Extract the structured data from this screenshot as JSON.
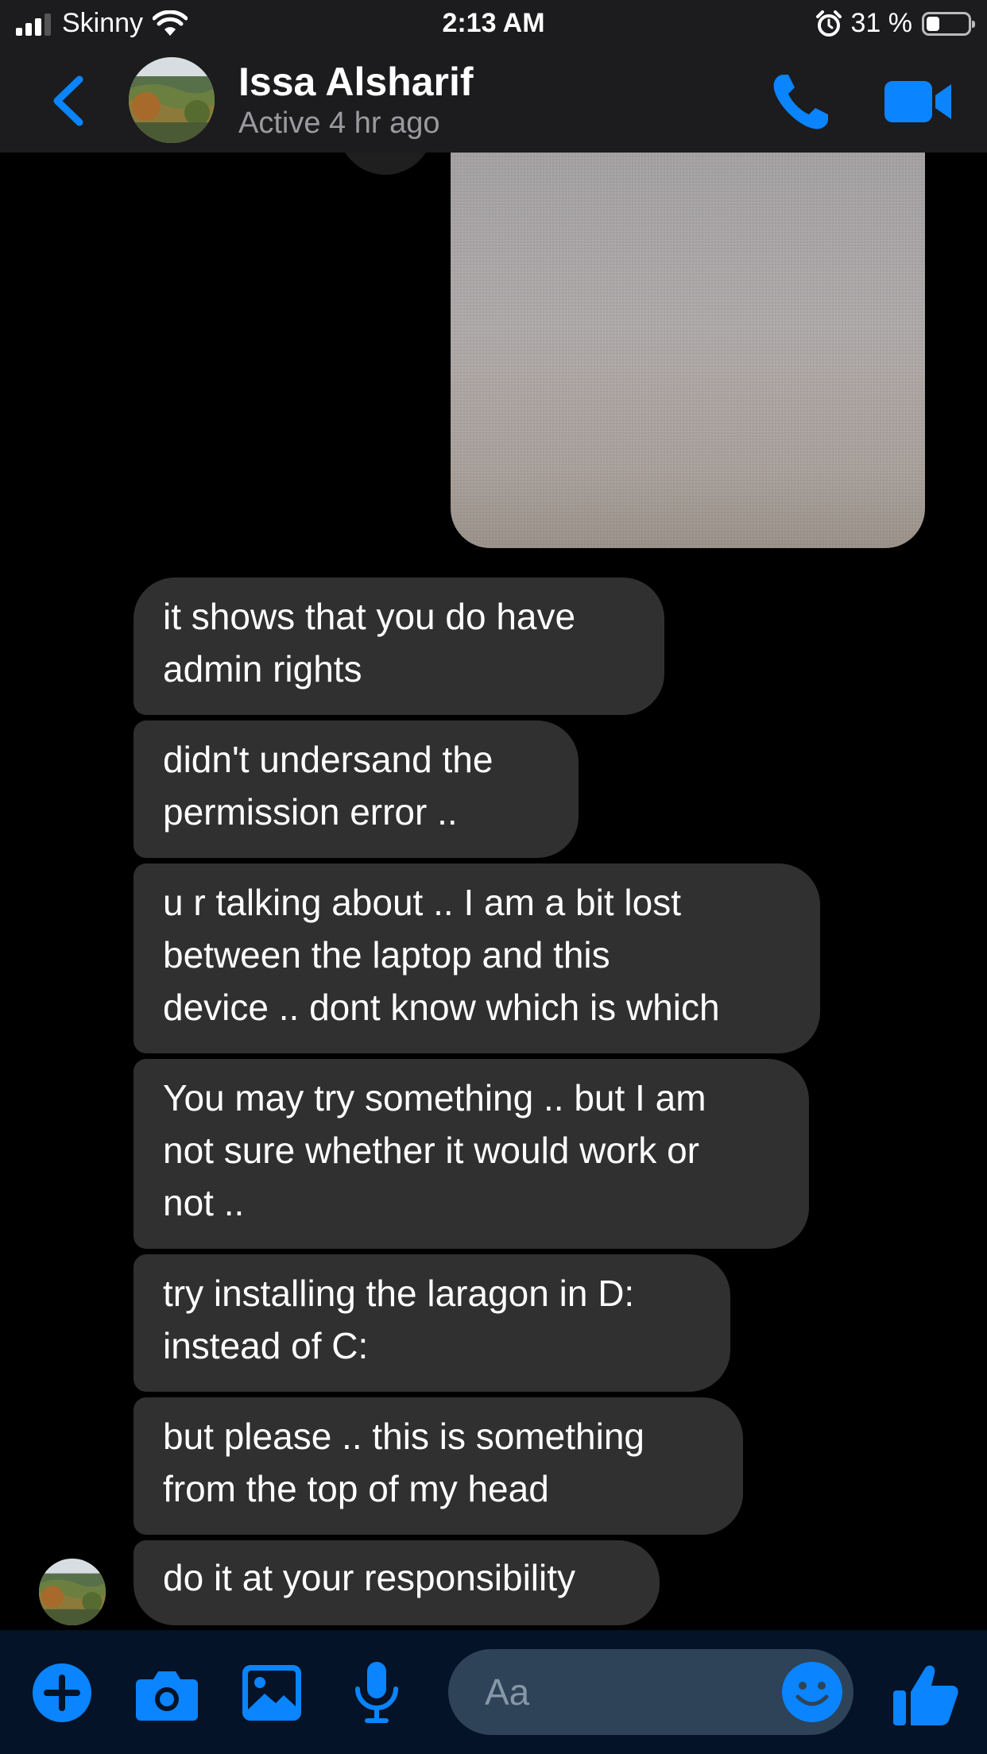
{
  "status_bar": {
    "carrier": "Skinny",
    "time": "2:13 AM",
    "battery_percent": "31 %",
    "battery_level": 0.31,
    "icons": [
      "signal-icon",
      "wifi-icon",
      "alarm-icon",
      "battery-icon"
    ]
  },
  "header": {
    "contact_name": "Issa Alsharif",
    "status": "Active 4 hr ago",
    "icons": [
      "back-chevron-icon",
      "phone-icon",
      "video-camera-icon"
    ]
  },
  "messages": [
    {
      "text": "it shows that you do have\nadmin rights"
    },
    {
      "text": "didn't undersand the\npermission error .."
    },
    {
      "text": "u r talking about .. I am a bit lost\nbetween the laptop and this\ndevice .. dont know which is which"
    },
    {
      "text": "You may try something .. but I am\nnot sure whether it would work or\nnot .."
    },
    {
      "text": "try installing the laragon in D:\ninstead of C:"
    },
    {
      "text": "but please .. this is something\nfrom the top of my head"
    },
    {
      "text": "do it at your responsibility"
    }
  ],
  "composer": {
    "placeholder": "Aa",
    "icons": [
      "plus-icon",
      "camera-icon",
      "image-icon",
      "microphone-icon",
      "emoji-icon",
      "thumbs-up-icon"
    ]
  },
  "colors": {
    "accent": "#0a84ff",
    "bubble_received": "#303030",
    "header_bg": "#1c1c1e",
    "composer_bg": "#041327",
    "input_bg": "#2e4358"
  }
}
